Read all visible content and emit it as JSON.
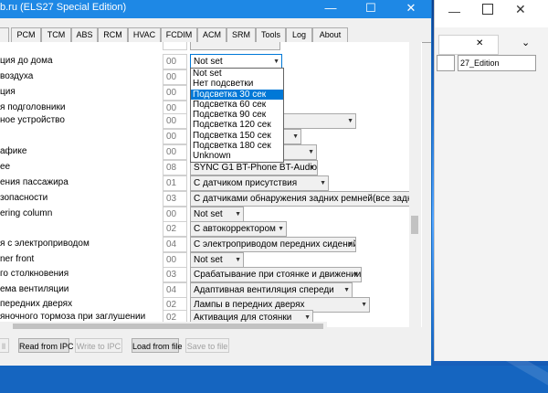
{
  "window": {
    "title": "b.ru (ELS27 Special Edition)",
    "tabs": [
      "PCM",
      "TCM",
      "ABS",
      "RCM",
      "HVAC",
      "FCDIM",
      "ACM",
      "SRM",
      "Tools",
      "Log",
      "About"
    ]
  },
  "rows": [
    {
      "label": "ция до дома",
      "num": "00",
      "value": "Not set"
    },
    {
      "label": "воздуха",
      "num": "00",
      "value": ""
    },
    {
      "label": "ция",
      "num": "00",
      "value": ""
    },
    {
      "label": "я подголовники",
      "num": "00",
      "value": ""
    },
    {
      "label": "ное устройство",
      "num": "00",
      "value": ""
    },
    {
      "label": "",
      "num": "00",
      "value": ""
    },
    {
      "label": "афике",
      "num": "00",
      "value": ""
    },
    {
      "label": "ее",
      "num": "08",
      "value": "SYNC G1 BT-Phone BT-Audio"
    },
    {
      "label": "ения пассажира",
      "num": "01",
      "value": "С датчиком присутствия"
    },
    {
      "label": "зопасности",
      "num": "03",
      "value": "С датчиками обнаружения задних ремней(все задние с"
    },
    {
      "label": "ering column",
      "num": "00",
      "value": "Not set"
    },
    {
      "label": "",
      "num": "02",
      "value": "С автокорректором"
    },
    {
      "label": "я с электроприводом",
      "num": "04",
      "value": "С электроприводом передних сидений"
    },
    {
      "label": "ner front",
      "num": "00",
      "value": "Not set"
    },
    {
      "label": "го столкновения",
      "num": "03",
      "value": "Срабатывание при стоянке и движении"
    },
    {
      "label": "ема вентиляции",
      "num": "04",
      "value": "Адаптивная вентиляция спереди"
    },
    {
      "label": "передних дверях",
      "num": "02",
      "value": "Лампы в передних дверях"
    },
    {
      "label": "яночного тормоза при заглушении",
      "num": "02",
      "value": "Активация для стоянки"
    }
  ],
  "dropdown": {
    "options": [
      "Not set",
      "Нет подсветки",
      "Подсветка 30 сек",
      "Подсветка 60 сек",
      "Подсветка 90 сек",
      "Подсветка 120 сек",
      "Подсветка 150 сек",
      "Подсветка 180 сек",
      "Unknown"
    ],
    "selected_index": 2
  },
  "buttons": {
    "btn0": "ll",
    "read_ipc": "Read from IPC",
    "write_ipc": "Write to IPC",
    "load_file": "Load from file",
    "save_file": "Save to file"
  },
  "bgwindow": {
    "field_text": "27_Edition"
  }
}
